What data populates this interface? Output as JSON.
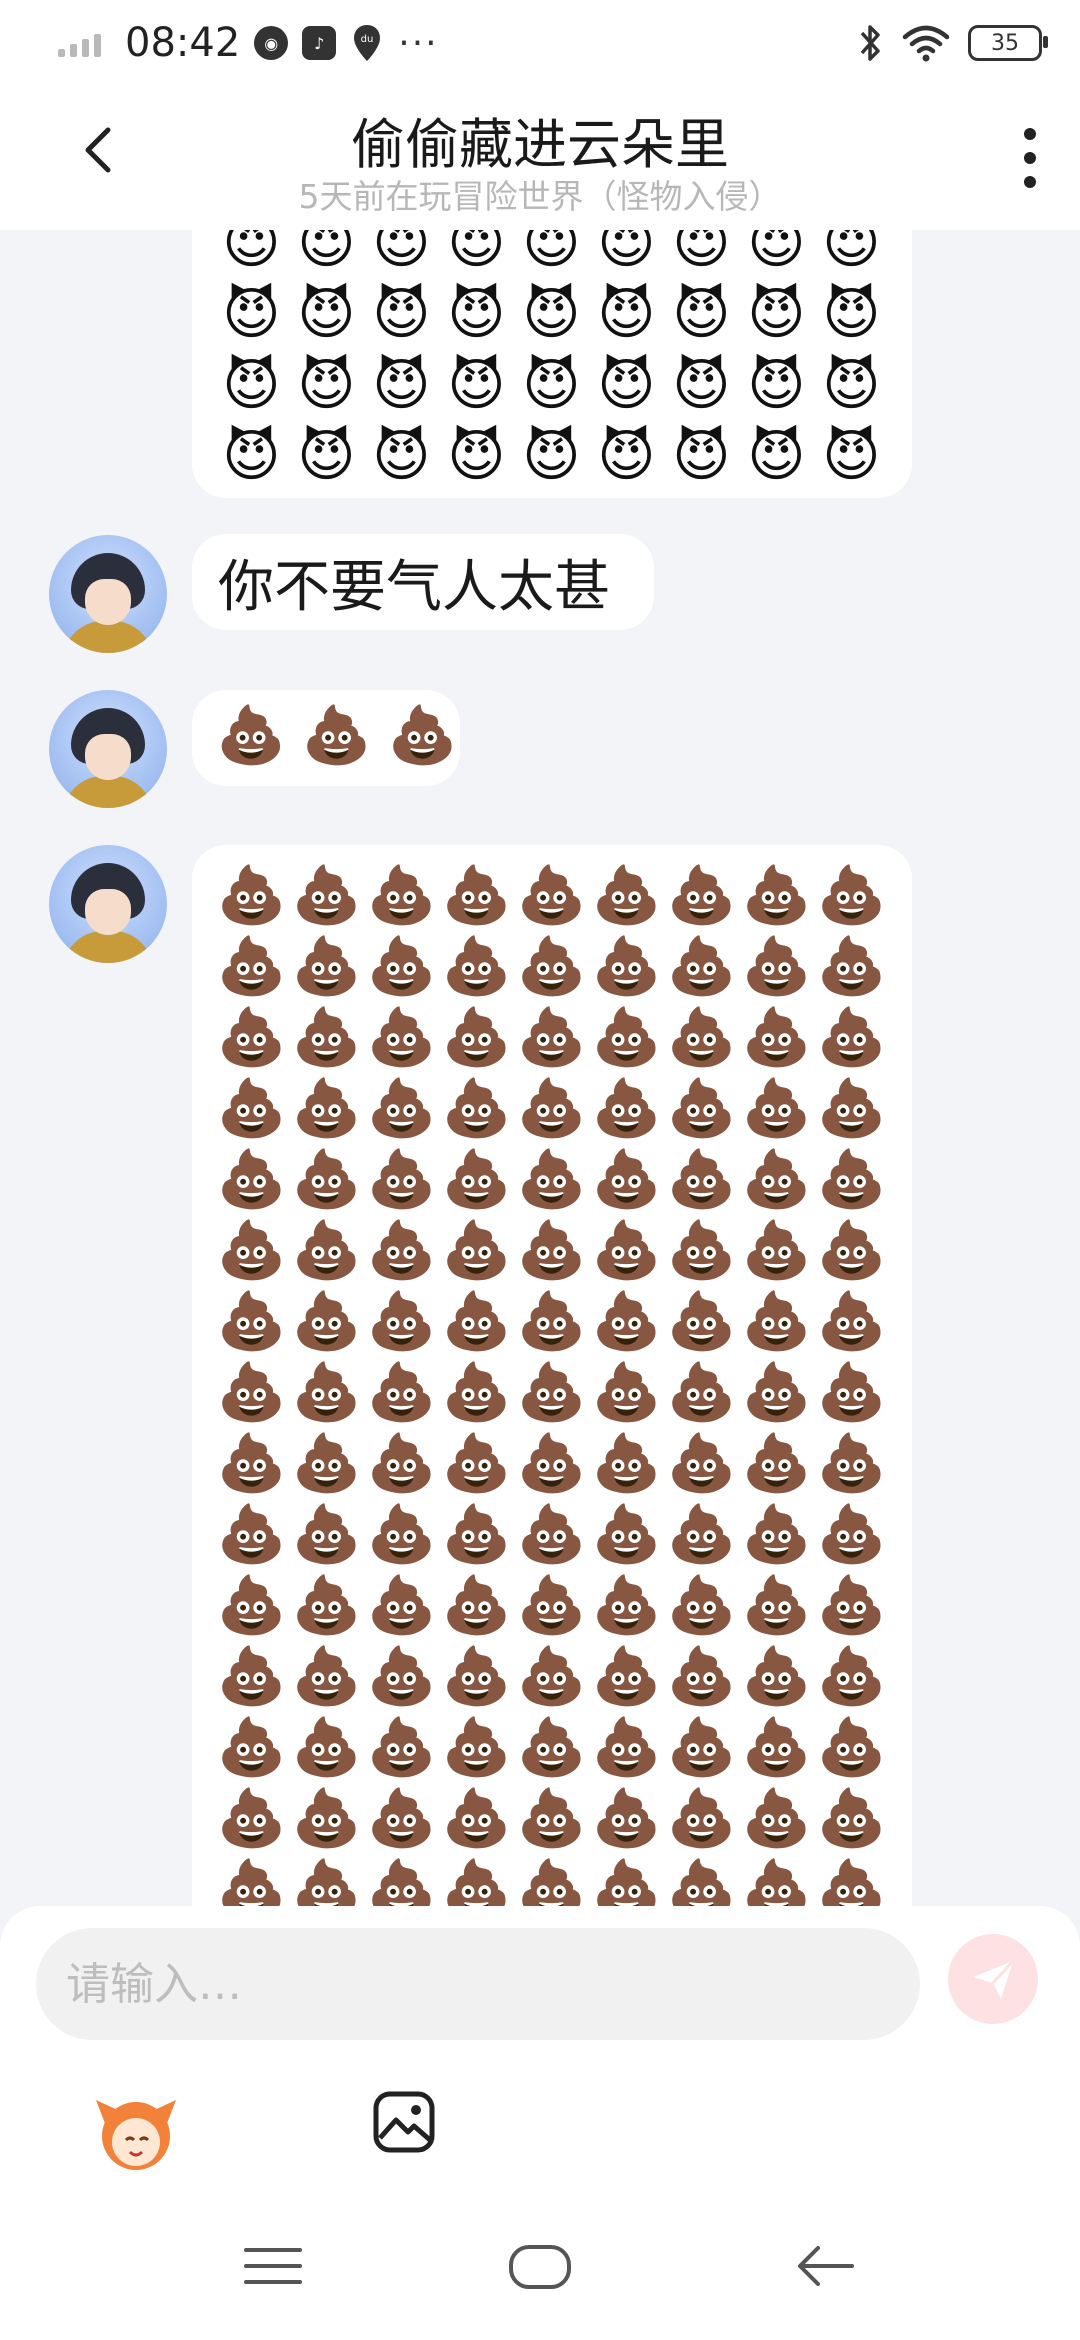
{
  "status_bar": {
    "time": "08:42",
    "battery": "35",
    "dots": "···",
    "app_badge": "du"
  },
  "header": {
    "title": "偷偷藏进云朵里",
    "subtitle": "5天前在玩冒险世界（怪物入侵）"
  },
  "messages": [
    {
      "type": "emoji_grid",
      "emoji": "😈",
      "rows_visible": 4,
      "cols": 9
    },
    {
      "type": "text",
      "text": "你不要气人太甚"
    },
    {
      "type": "emoji_row",
      "emoji": "💩",
      "count": 3
    },
    {
      "type": "emoji_grid",
      "emoji": "💩",
      "rows_visible": 15,
      "cols": 9
    }
  ],
  "composer": {
    "placeholder": "请输入…"
  },
  "colors": {
    "background": "#f2f4f8",
    "bubble": "#ffffff",
    "send_button": "#fde1e3",
    "accent": "#ff8a8a"
  },
  "icons": [
    "back-arrow-icon",
    "more-vert-icon",
    "send-icon",
    "emoji-mascot-icon",
    "image-icon",
    "menu-icon",
    "home-icon",
    "back-nav-icon",
    "bluetooth-icon",
    "wifi-icon"
  ]
}
